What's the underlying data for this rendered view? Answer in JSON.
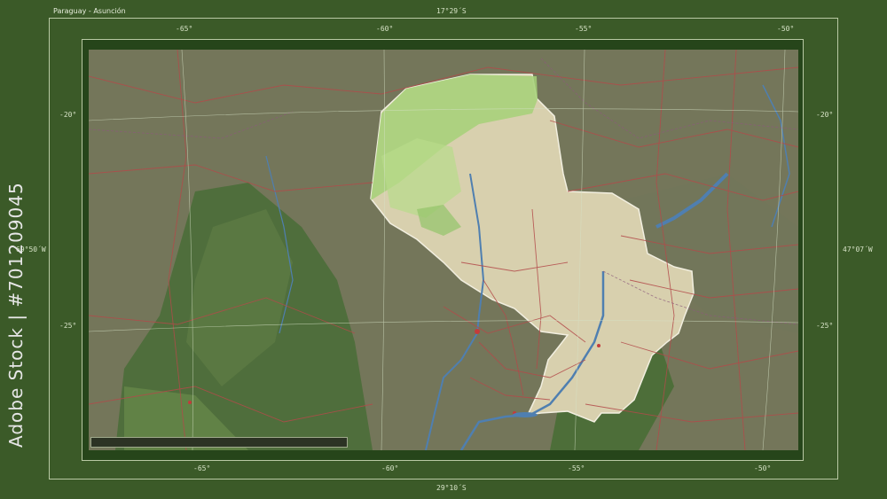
{
  "map": {
    "title": "Paraguay - Asunción",
    "top_center_label": "17°29´S",
    "bottom_center_label": "29°10´S",
    "left_center_label": "69°50´W",
    "right_center_label": "47°07´W",
    "lon_ticks_top": [
      "-65°",
      "-60°",
      "-55°",
      "-50°"
    ],
    "lon_ticks_bottom": [
      "-65°",
      "-60°",
      "-55°",
      "-50°"
    ],
    "lat_ticks_left": [
      "-20°",
      "-25°"
    ],
    "lat_ticks_right": [
      "-20°",
      "-25°"
    ],
    "watermark_id": "Adobe Stock | #701209045",
    "colors": {
      "frame": "#3b5a28",
      "inner_band": "#26451a",
      "country_highlight": "#d9d2b0",
      "chaco_green": "#a7d27a",
      "river": "#4f7fb0",
      "road": "#b34a4a"
    }
  }
}
